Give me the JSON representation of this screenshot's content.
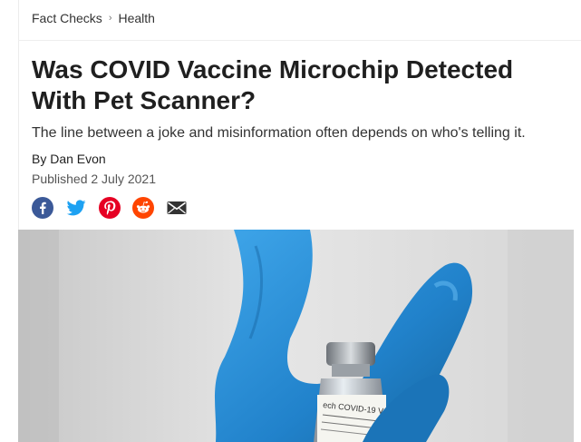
{
  "breadcrumb": {
    "items": [
      "Fact Checks",
      "Health"
    ],
    "separator": "›"
  },
  "article": {
    "title": "Was COVID Vaccine Microchip Detected With Pet Scanner?",
    "subtitle": "The line between a joke and misinformation often depends on who's telling it.",
    "byline": "By Dan Evon",
    "published": "Published 2 July 2021"
  },
  "share": {
    "icons": [
      "facebook-icon",
      "twitter-icon",
      "pinterest-icon",
      "reddit-icon",
      "email-icon"
    ],
    "colors": {
      "facebook": "#3b5998",
      "twitter": "#1da1f2",
      "pinterest": "#e60023",
      "reddit": "#ff4500",
      "email": "#333333"
    }
  },
  "hero_image": {
    "vial_label": "ech COVID-19 Vaccine",
    "glove_color": "#2b8fd6"
  }
}
